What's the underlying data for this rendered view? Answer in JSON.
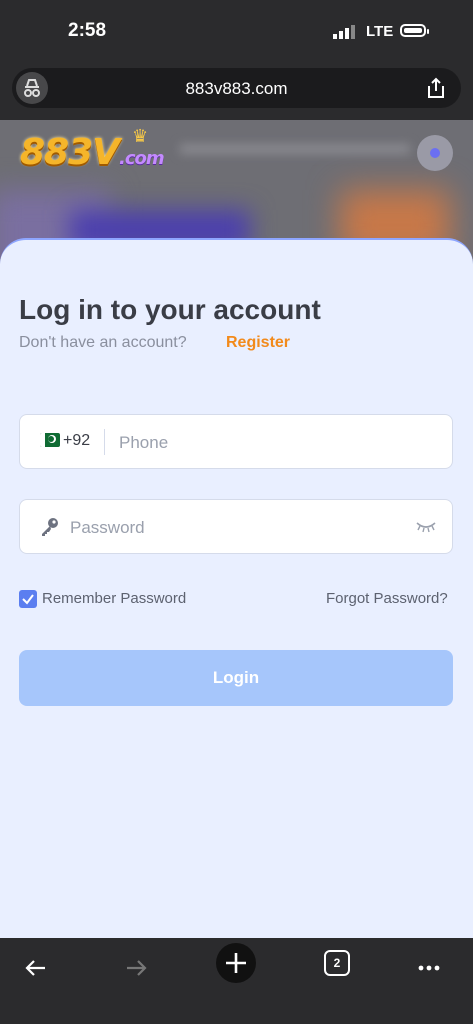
{
  "status_bar": {
    "time": "2:58",
    "network": "LTE"
  },
  "browser": {
    "url": "883v883.com",
    "tab_count": "2"
  },
  "site": {
    "logo_main": "883V",
    "logo_suffix": ".com"
  },
  "login": {
    "title": "Log in to your account",
    "no_account_text": "Don't have an account?",
    "register_link": "Register",
    "country_code": "+92",
    "phone_placeholder": "Phone",
    "password_placeholder": "Password",
    "remember_label": "Remember Password",
    "remember_checked": true,
    "forgot_link": "Forgot Password?",
    "login_button": "Login"
  },
  "icons": {
    "status": [
      "signal-icon",
      "battery-icon"
    ],
    "url_bar": [
      "incognito-icon",
      "share-icon"
    ],
    "form": [
      "pakistan-flag-icon",
      "key-icon",
      "eye-closed-icon",
      "checkbox-checked-icon"
    ],
    "toolbar": [
      "back-arrow-icon",
      "forward-arrow-icon",
      "new-tab-plus-icon",
      "tabs-count-icon",
      "more-dots-icon"
    ]
  },
  "colors": {
    "accent_orange": "#f28a1b",
    "login_button": "#a6c6fb",
    "checkbox": "#5b7ef0",
    "sheet_bg": "#e9efff"
  }
}
